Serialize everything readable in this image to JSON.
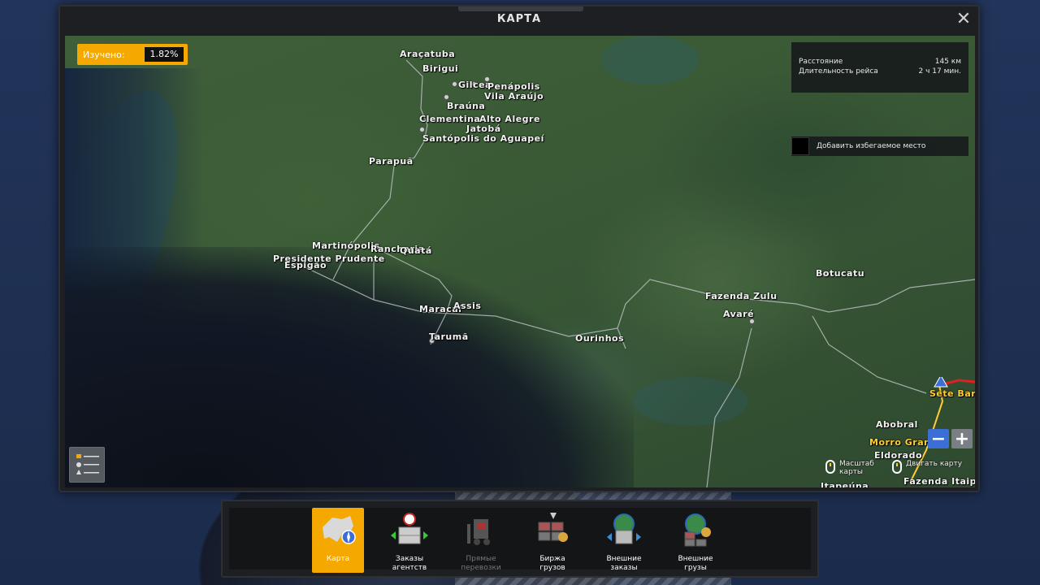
{
  "window": {
    "title": "КАРТА",
    "close_icon": "close-icon"
  },
  "explored": {
    "label": "Изучено:",
    "value": "1.82%"
  },
  "route_info": {
    "distance_label": "Расстояние",
    "distance_value": "145 км",
    "duration_label": "Длительность рейса",
    "duration_value": "2 ч 17 мин."
  },
  "avoid_button": {
    "label": "Добавить избегаемое место"
  },
  "hints": {
    "zoom_hint": "Масштаб карты",
    "drag_hint": "Двигать карту"
  },
  "cities": [
    {
      "name": "Araçatuba"
    },
    {
      "name": "Birigui"
    },
    {
      "name": "Gilcea"
    },
    {
      "name": "Penápolis"
    },
    {
      "name": "Vila Araújo"
    },
    {
      "name": "Braúna"
    },
    {
      "name": "Clementina"
    },
    {
      "name": "Alto Alegre"
    },
    {
      "name": "Jatobá"
    },
    {
      "name": "Santópolis do Aguapeí"
    },
    {
      "name": "Parapuã"
    },
    {
      "name": "Martinópolis"
    },
    {
      "name": "Rancharia"
    },
    {
      "name": "Quatá"
    },
    {
      "name": "Presidente Prudente"
    },
    {
      "name": "Espigão"
    },
    {
      "name": "Maracaí"
    },
    {
      "name": "Assis"
    },
    {
      "name": "Tarumã"
    },
    {
      "name": "Ourinhos"
    },
    {
      "name": "Fazenda Zulu"
    },
    {
      "name": "Avaré"
    },
    {
      "name": "Botucatu"
    },
    {
      "name": "Abobral"
    },
    {
      "name": "Morro Grande"
    },
    {
      "name": "Eldorado"
    },
    {
      "name": "Sete Barras"
    },
    {
      "name": "Fazenda Itaipé"
    },
    {
      "name": "Itapeúna"
    }
  ],
  "toolbar": {
    "items": [
      {
        "label": "Карта",
        "state": "active",
        "icon": "map-icon"
      },
      {
        "label": "Заказы агентств",
        "state": "normal",
        "icon": "agency-orders-icon"
      },
      {
        "label": "Прямые перевозки",
        "state": "disabled",
        "icon": "forklift-icon"
      },
      {
        "label": "Биржа грузов",
        "state": "normal",
        "icon": "cargo-market-icon"
      },
      {
        "label": "Внешние заказы",
        "state": "normal",
        "icon": "external-orders-icon"
      },
      {
        "label": "Внешние грузы",
        "state": "normal",
        "icon": "external-cargo-icon"
      }
    ]
  },
  "colors": {
    "accent": "#f5a800",
    "zoom_out": "#3b6fd6",
    "route": "#ffcc33",
    "avoid": "#e02020"
  }
}
